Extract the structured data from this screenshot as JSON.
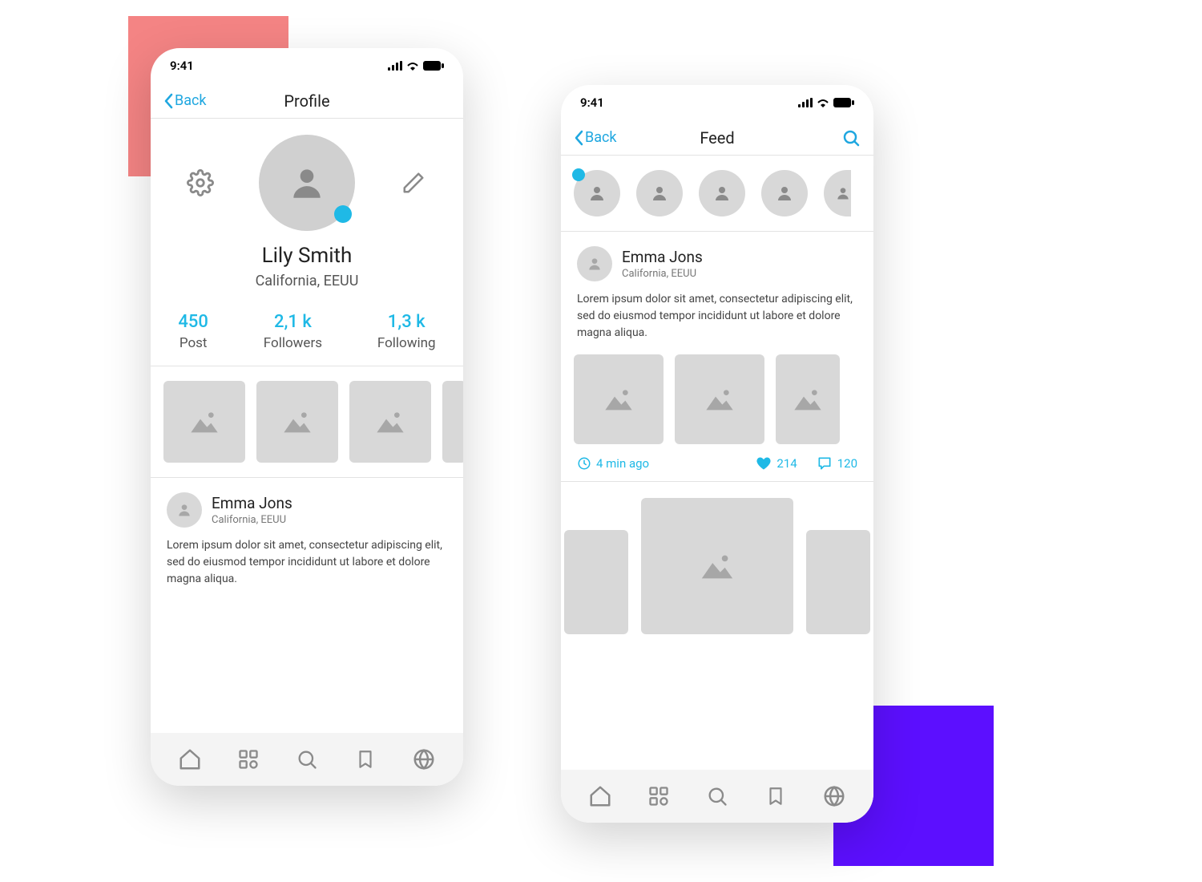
{
  "shared": {
    "status_time": "9:41",
    "back_label": "Back",
    "lorem": "Lorem ipsum dolor sit amet, consectetur adipiscing elit, sed do eiusmod tempor incididunt ut labore et dolore magna aliqua."
  },
  "profile_screen": {
    "title": "Profile",
    "user": {
      "name": "Lily Smith",
      "location": "California, EEUU"
    },
    "stats": {
      "posts": {
        "value": "450",
        "label": "Post"
      },
      "followers": {
        "value": "2,1 k",
        "label": "Followers"
      },
      "following": {
        "value": "1,3 k",
        "label": "Following"
      }
    },
    "feed_preview": {
      "author": "Emma Jons",
      "location": "California, EEUU"
    }
  },
  "feed_screen": {
    "title": "Feed",
    "post": {
      "author": "Emma Jons",
      "location": "California, EEUU",
      "time_ago": "4 min ago",
      "likes": "214",
      "comments": "120"
    }
  },
  "colors": {
    "accent": "#1fb9e6",
    "link": "#1fa7e0",
    "pink": "#f48484",
    "purple": "#5c0fff"
  }
}
